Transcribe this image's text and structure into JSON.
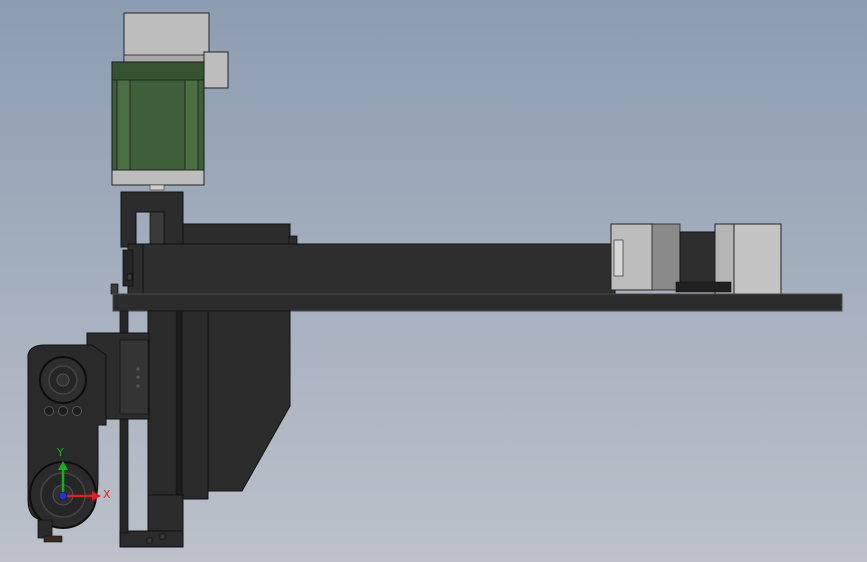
{
  "viewport": {
    "background_top": "#8c9cb1",
    "background_bottom": "#bcc1ca"
  },
  "colors": {
    "dark_body": "#2c2c2c",
    "plate_edge": "#4a4a4a",
    "motor_green": "#3f5f3a",
    "motor_gray": "#bdbdbd",
    "axis_x": "#e02020",
    "axis_y": "#18b018",
    "axis_origin": "#2233dd"
  },
  "triad": {
    "x_label": "X",
    "y_label": "Y",
    "icon": "coordinate-triad-icon"
  }
}
